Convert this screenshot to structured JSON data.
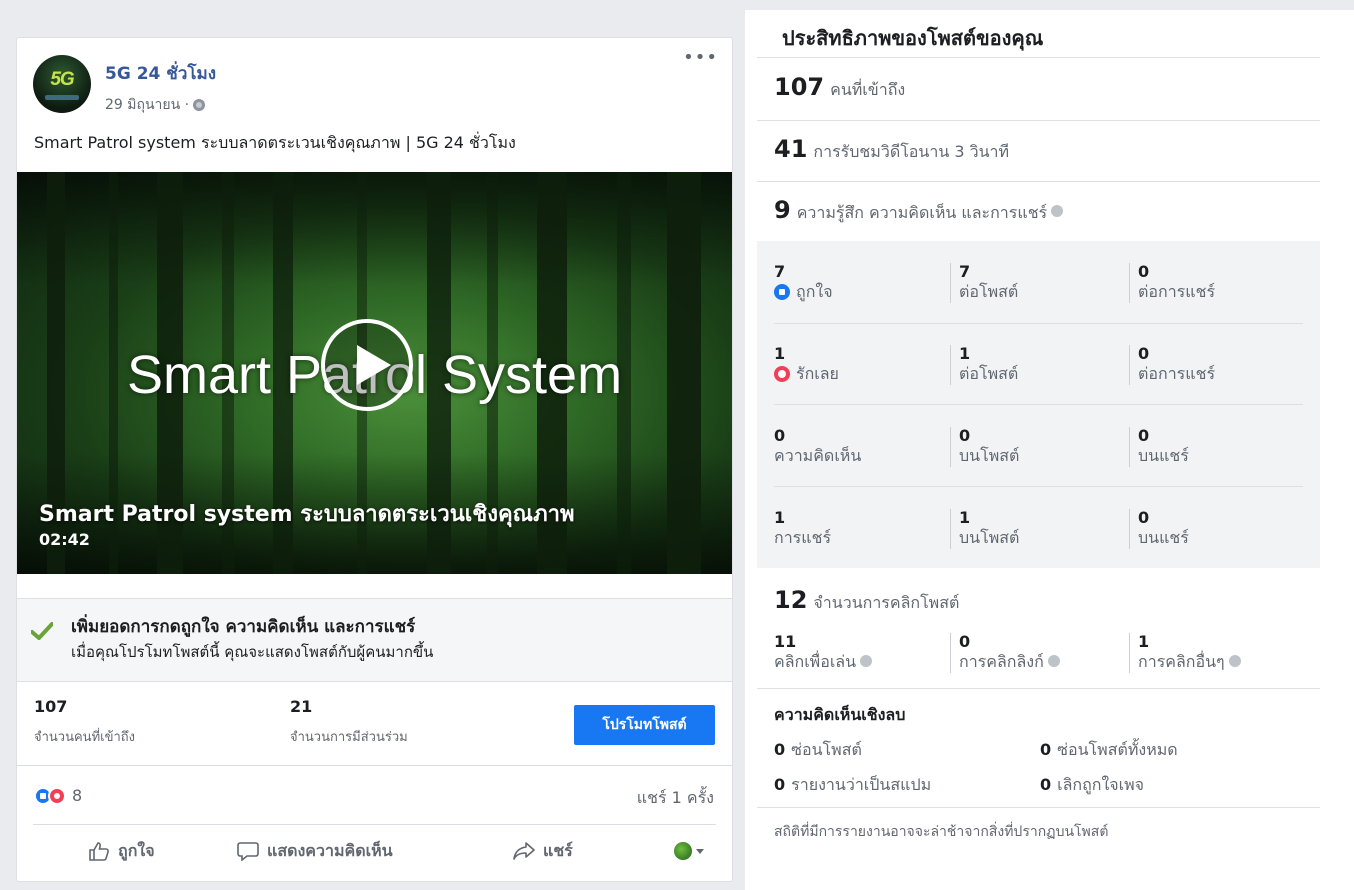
{
  "post": {
    "page_name": "5G 24 ชั่วโมง",
    "avatar_text": "5G",
    "date": "29 มิถุนายน ·",
    "more": "•••",
    "text": "Smart Patrol system ระบบลาดตระเวนเชิงคุณภาพ | 5G 24 ชั่วโมง",
    "video": {
      "title_overlay": "Smart Patrol System",
      "caption": "Smart Patrol system ระบบลาดตระเวนเชิงคุณภาพ",
      "duration": "02:42"
    },
    "promo": {
      "title": "เพิ่มยอดการกดถูกใจ ความคิดเห็น และการแชร์",
      "desc": "เมื่อคุณโปรโมทโพสต์นี้ คุณจะแสดงโพสต์กับผู้คนมากขึ้น"
    },
    "stats": [
      {
        "value": "107",
        "label": "จำนวนคนที่เข้าถึง"
      },
      {
        "value": "21",
        "label": "จำนวนการมีส่วนร่วม"
      }
    ],
    "promote_button": "โปรโมทโพสต์",
    "reaction_count": "8",
    "share_count": "แชร์ 1 ครั้ง",
    "actions": {
      "like": "ถูกใจ",
      "comment": "แสดงความคิดเห็น",
      "share": "แชร์"
    }
  },
  "insights": {
    "title": "ประสิทธิภาพของโพสต์ของคุณ",
    "reach": {
      "value": "107",
      "label": "คนที่เข้าถึง"
    },
    "views": {
      "value": "41",
      "label": "การรับชมวิดีโอนาน 3 วินาที"
    },
    "engagement": {
      "value": "9",
      "label": "ความรู้สึก ความคิดเห็น และการแชร์"
    },
    "rows": [
      [
        {
          "n": "7",
          "l": "ถูกใจ"
        },
        {
          "n": "7",
          "l": "ต่อโพสต์"
        },
        {
          "n": "0",
          "l": "ต่อการแชร์"
        }
      ],
      [
        {
          "n": "1",
          "l": "รักเลย"
        },
        {
          "n": "1",
          "l": "ต่อโพสต์"
        },
        {
          "n": "0",
          "l": "ต่อการแชร์"
        }
      ],
      [
        {
          "n": "0",
          "l": "ความคิดเห็น"
        },
        {
          "n": "0",
          "l": "บนโพสต์"
        },
        {
          "n": "0",
          "l": "บนแชร์"
        }
      ],
      [
        {
          "n": "1",
          "l": "การแชร์"
        },
        {
          "n": "1",
          "l": "บนโพสต์"
        },
        {
          "n": "0",
          "l": "บนแชร์"
        }
      ]
    ],
    "clicks": {
      "value": "12",
      "label": "จำนวนการคลิกโพสต์"
    },
    "click_rows": [
      {
        "n": "11",
        "l": "คลิกเพื่อเล่น"
      },
      {
        "n": "0",
        "l": "การคลิกลิงก์"
      },
      {
        "n": "1",
        "l": "การคลิกอื่นๆ"
      }
    ],
    "negative_title": "ความคิดเห็นเชิงลบ",
    "negative": [
      {
        "n": "0",
        "l": "ซ่อนโพสต์"
      },
      {
        "n": "0",
        "l": "ซ่อนโพสต์ทั้งหมด"
      },
      {
        "n": "0",
        "l": "รายงานว่าเป็นสแปม"
      },
      {
        "n": "0",
        "l": "เลิกถูกใจเพจ"
      }
    ],
    "footnote": "สถิติที่มีการรายงานอาจจะล่าช้าจากสิ่งที่ปรากฏบนโพสต์"
  }
}
